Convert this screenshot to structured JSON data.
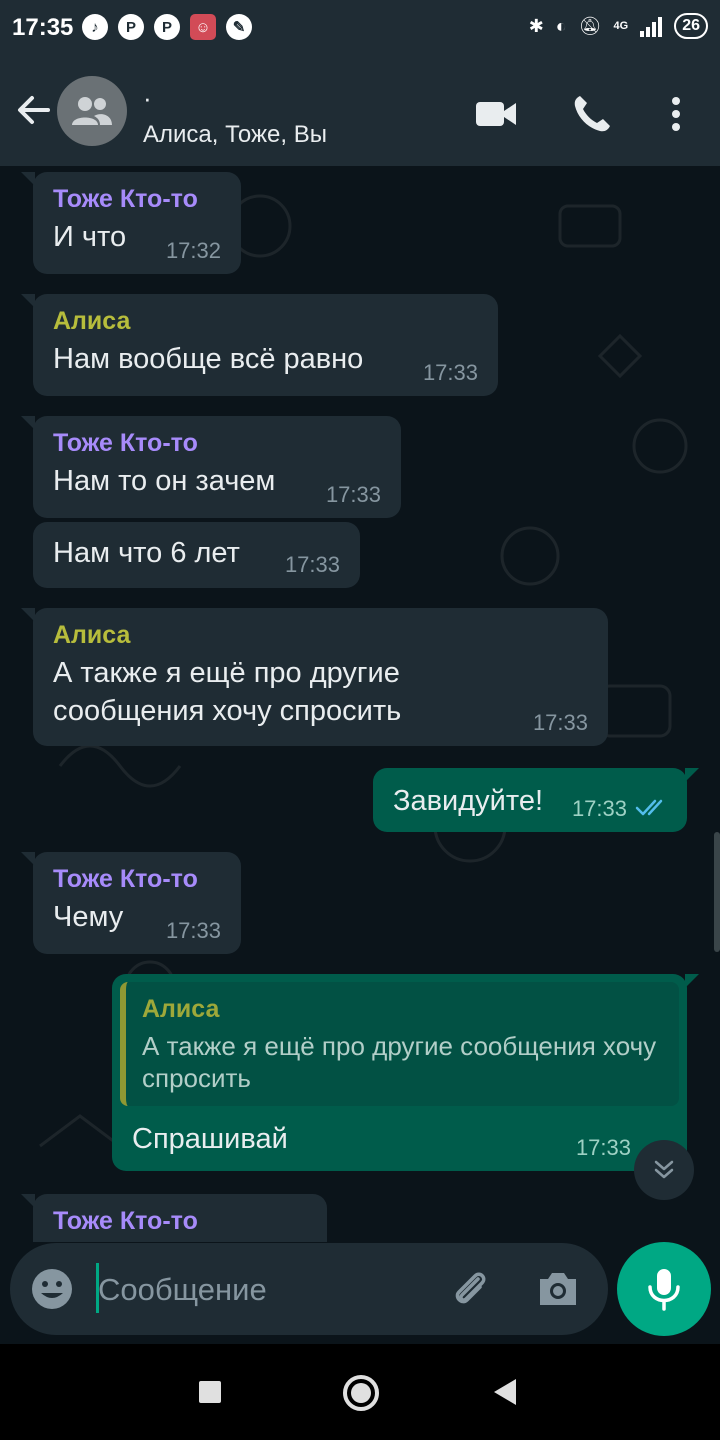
{
  "status_bar": {
    "time": "17:35",
    "apps": [
      "tiktok-icon",
      "pinterest-icon",
      "pinterest-icon",
      "game-icon",
      "broom-icon"
    ],
    "network": "4G",
    "battery": "26"
  },
  "header": {
    "title": "·",
    "subtitle": "Алиса, Тоже, Вы"
  },
  "messages": [
    {
      "sender": "Тоже Кто-то",
      "text": "И что",
      "time": "17:32"
    },
    {
      "sender": "Алиса",
      "text": "Нам вообще всё равно",
      "time": "17:33"
    },
    {
      "sender": "Тоже Кто-то",
      "text": "Нам то он зачем",
      "time": "17:33"
    },
    {
      "text": "Нам что 6 лет",
      "time": "17:33"
    },
    {
      "sender": "Алиса",
      "text": "А также я ещё про другие сообщения хочу спросить",
      "time": "17:33"
    },
    {
      "text": "Завидуйте!",
      "time": "17:33",
      "status": "read"
    },
    {
      "sender": "Тоже Кто-то",
      "text": "Чему",
      "time": "17:33"
    },
    {
      "quote": {
        "sender": "Алиса",
        "text": "А также я ещё про другие сообщения хочу спросить"
      },
      "text": "Спрашивай",
      "time": "17:33"
    },
    {
      "sender": "Тоже Кто-то"
    }
  ],
  "input": {
    "placeholder": "Сообщение"
  },
  "colors": {
    "background": "#0b141a",
    "incoming_bubble": "#1f2c34",
    "outgoing_bubble": "#005c4b",
    "accent": "#00a884",
    "sender_purple": "#a78bfa",
    "sender_olive": "#b7bd3c",
    "read_ticks": "#53bdeb"
  }
}
